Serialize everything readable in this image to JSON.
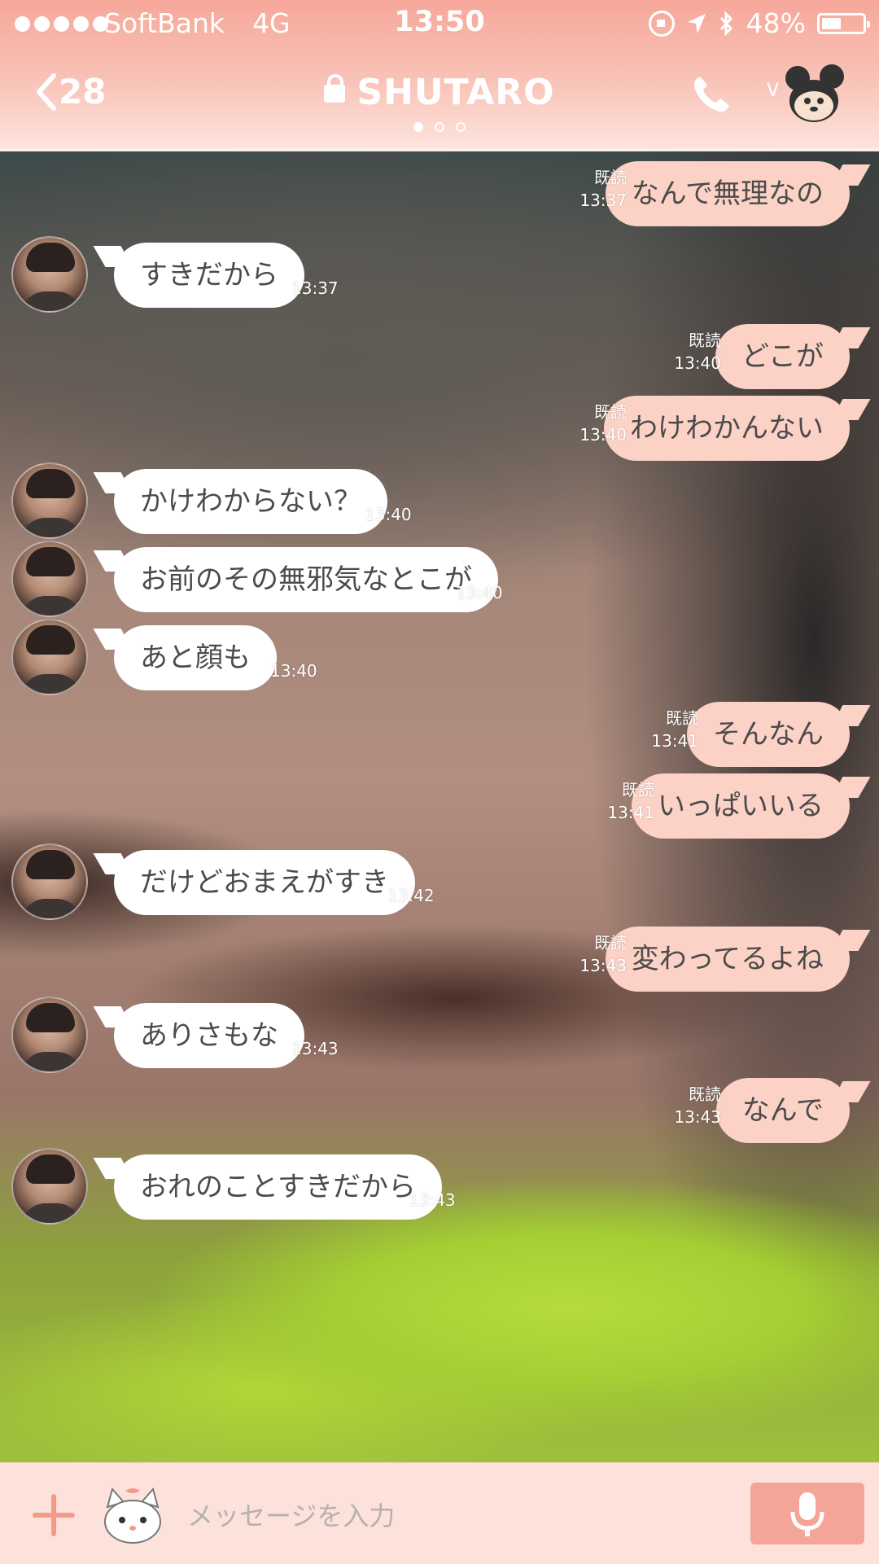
{
  "status": {
    "carrier": "SoftBank",
    "network": "4G",
    "time": "13:50",
    "battery": "48%",
    "battery_level": 0.48
  },
  "nav": {
    "back_count": "28",
    "title": "SHUTARO"
  },
  "messages": [
    {
      "dir": "out",
      "text": "なんで無理なの",
      "read": "既読",
      "time": "13:37"
    },
    {
      "dir": "in",
      "text": "すきだから",
      "time": "13:37"
    },
    {
      "dir": "out",
      "text": "どこが",
      "read": "既読",
      "time": "13:40"
    },
    {
      "dir": "out",
      "text": "わけわかんない",
      "read": "既読",
      "time": "13:40"
    },
    {
      "dir": "in",
      "text": "かけわからない？",
      "time": "13:40"
    },
    {
      "dir": "in",
      "text": "お前のその無邪気なとこが",
      "time": "13:40"
    },
    {
      "dir": "in",
      "text": "あと顔も",
      "time": "13:40"
    },
    {
      "dir": "out",
      "text": "そんなん",
      "read": "既読",
      "time": "13:41"
    },
    {
      "dir": "out",
      "text": "いっぱいいる",
      "read": "既読",
      "time": "13:41"
    },
    {
      "dir": "in",
      "text": "だけどおまえがすき",
      "time": "13:42"
    },
    {
      "dir": "out",
      "text": "変わってるよね",
      "read": "既読",
      "time": "13:43"
    },
    {
      "dir": "in",
      "text": "ありさもな",
      "time": "13:43"
    },
    {
      "dir": "out",
      "text": "なんで",
      "read": "既読",
      "time": "13:43"
    },
    {
      "dir": "in",
      "text": "おれのことすきだから",
      "time": "13:43"
    }
  ],
  "input": {
    "placeholder": "メッセージを入力"
  },
  "icons": {
    "back": "chevron-left-icon",
    "lock": "lock-icon",
    "call": "phone-icon",
    "mascot": "mouse-mascot-icon",
    "plus": "plus-icon",
    "sticker": "cat-sticker-icon",
    "mic": "microphone-icon"
  },
  "colors": {
    "header": "#f6a79a",
    "out_bubble": "#fcd2c6",
    "in_bubble": "#ffffff",
    "mic_button": "#f5a597"
  }
}
